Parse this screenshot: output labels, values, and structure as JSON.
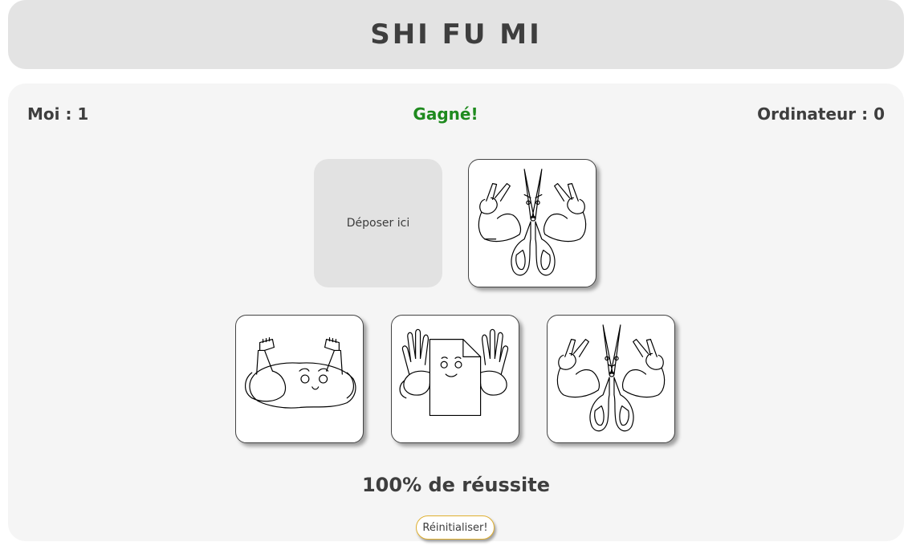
{
  "header": {
    "title": "SHI FU MI"
  },
  "scores": {
    "player": "Moi : 1",
    "computer": "Ordinateur : 0"
  },
  "result": {
    "text": "Gagné!",
    "color": "#1e8a1e"
  },
  "drop_zone": {
    "label": "Déposer ici"
  },
  "computer_choice": {
    "icon": "scissors-icon"
  },
  "choices": [
    {
      "icon": "rock-icon"
    },
    {
      "icon": "paper-icon"
    },
    {
      "icon": "scissors-icon"
    }
  ],
  "stats": {
    "success_rate": "100% de réussite"
  },
  "reset_button": {
    "label": "Réinitialiser!",
    "border_color": "#e0b030"
  }
}
